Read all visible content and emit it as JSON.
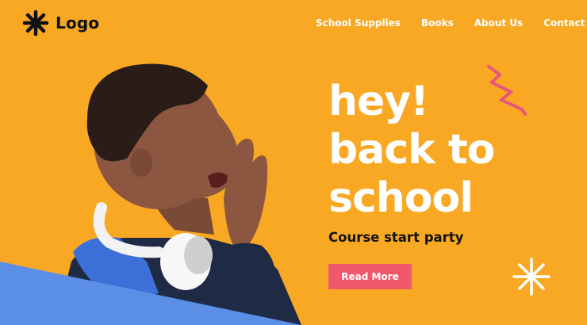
{
  "brand": {
    "logo_text": "Logo",
    "icon": "asterisk-icon"
  },
  "nav": {
    "items": [
      {
        "label": "School Supplies"
      },
      {
        "label": "Books"
      },
      {
        "label": "About Us"
      },
      {
        "label": "Contact"
      }
    ]
  },
  "hero": {
    "title_lines": [
      "hey!",
      "back to",
      "school"
    ],
    "subtitle": "Course start party",
    "cta_label": "Read More"
  },
  "colors": {
    "background": "#F9A824",
    "cta": "#F0596B",
    "wedge": "#5B8FE6",
    "zigzag": "#E8567A"
  }
}
